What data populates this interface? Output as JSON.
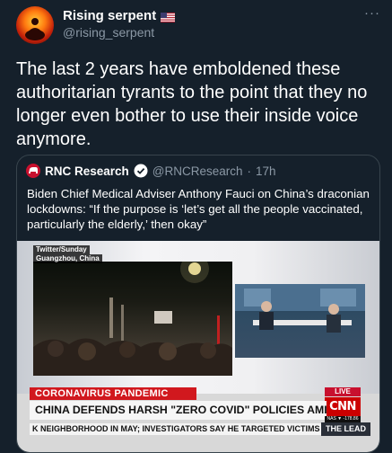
{
  "tweet": {
    "display_name": "Rising serpent",
    "handle": "@rising_serpent",
    "more_icon": "more-horizontal-icon",
    "text": "The last 2 years have emboldened these authoritarian tyrants to the point that they no longer even bother to use their inside voice anymore.",
    "flag": "us-flag"
  },
  "quote": {
    "display_name": "RNC Research",
    "handle": "@RNCResearch",
    "time": "17h",
    "verified": true,
    "text": "Biden Chief Medical Adviser Anthony Fauci on China’s draconian lockdowns: “If the purpose is ‘let’s get all the people vaccinated, particularly the elderly,’ then okay”"
  },
  "media": {
    "source_label": "Twitter/Sunday",
    "location_label": "Guangzhou, China",
    "banner_label": "CORONAVIRUS PANDEMIC",
    "live_label": "LIVE",
    "network": "CNN",
    "headline": "CHINA DEFENDS HARSH \"ZERO COVID\" POLICIES AMID NATIONWIDE PROTESTS",
    "ticker": "K NEIGHBORHOOD IN MAY; INVESTIGATORS SAY HE TARGETED VICTIMS BAS",
    "ticker_mini": "NAS ▼ -178.86",
    "show_name": "THE LEAD"
  },
  "colors": {
    "background": "#15202b",
    "secondary_text": "#8b98a5",
    "border": "#38444d",
    "cnn_red": "#cc0000",
    "verified_blue": "#1d9bf0"
  }
}
